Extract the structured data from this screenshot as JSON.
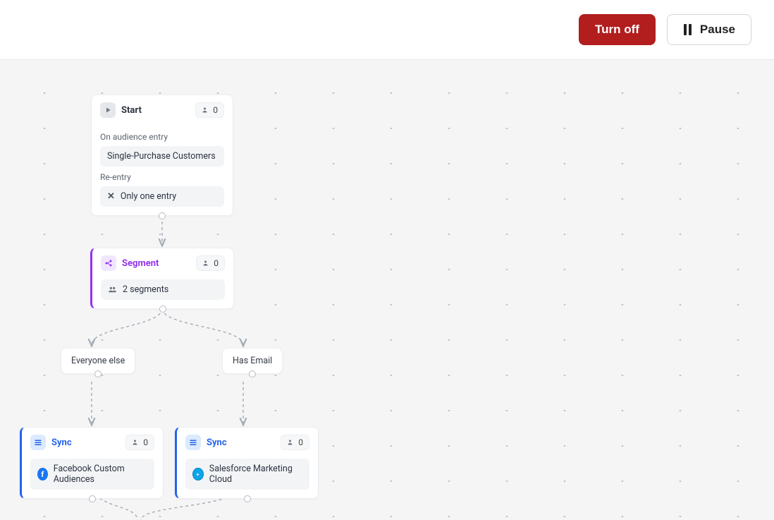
{
  "header": {
    "turn_off": "Turn off",
    "pause": "Pause"
  },
  "nodes": {
    "start": {
      "title": "Start",
      "count": "0",
      "section1_label": "On audience entry",
      "audience": "Single-Purchase Customers",
      "section2_label": "Re-entry",
      "reentry": "Only one entry"
    },
    "segment": {
      "title": "Segment",
      "count": "0",
      "summary": "2 segments"
    },
    "branch_left": "Everyone else",
    "branch_right": "Has Email",
    "sync_left": {
      "title": "Sync",
      "count": "0",
      "target": "Facebook Custom Audiences"
    },
    "sync_right": {
      "title": "Sync",
      "count": "0",
      "target": "Salesforce Marketing Cloud"
    }
  }
}
